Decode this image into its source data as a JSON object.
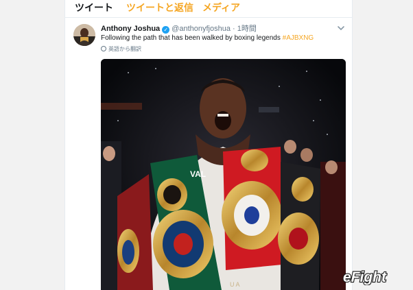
{
  "tabs": {
    "tweets_label": "ツイート",
    "replies_label": "ツイートと返信",
    "media_label": "メディア"
  },
  "tweet": {
    "display_name": "Anthony Joshua",
    "handle": "@anthonyfjoshua",
    "separator": "·",
    "time": "1時間",
    "text": "Following the path that has been walked by boxing legends",
    "hashtag": "#AJBXNG",
    "translate_label": "英語から翻訳",
    "photo": {
      "belt_texts": [
        "VAL",
        "U A"
      ]
    }
  },
  "watermark": {
    "text": "eFight"
  },
  "colors": {
    "accent": "#f5a623",
    "verified": "#1da1f2",
    "muted": "#657786"
  },
  "icons": [
    "verified-badge-icon",
    "chevron-down-icon",
    "globe-icon"
  ]
}
